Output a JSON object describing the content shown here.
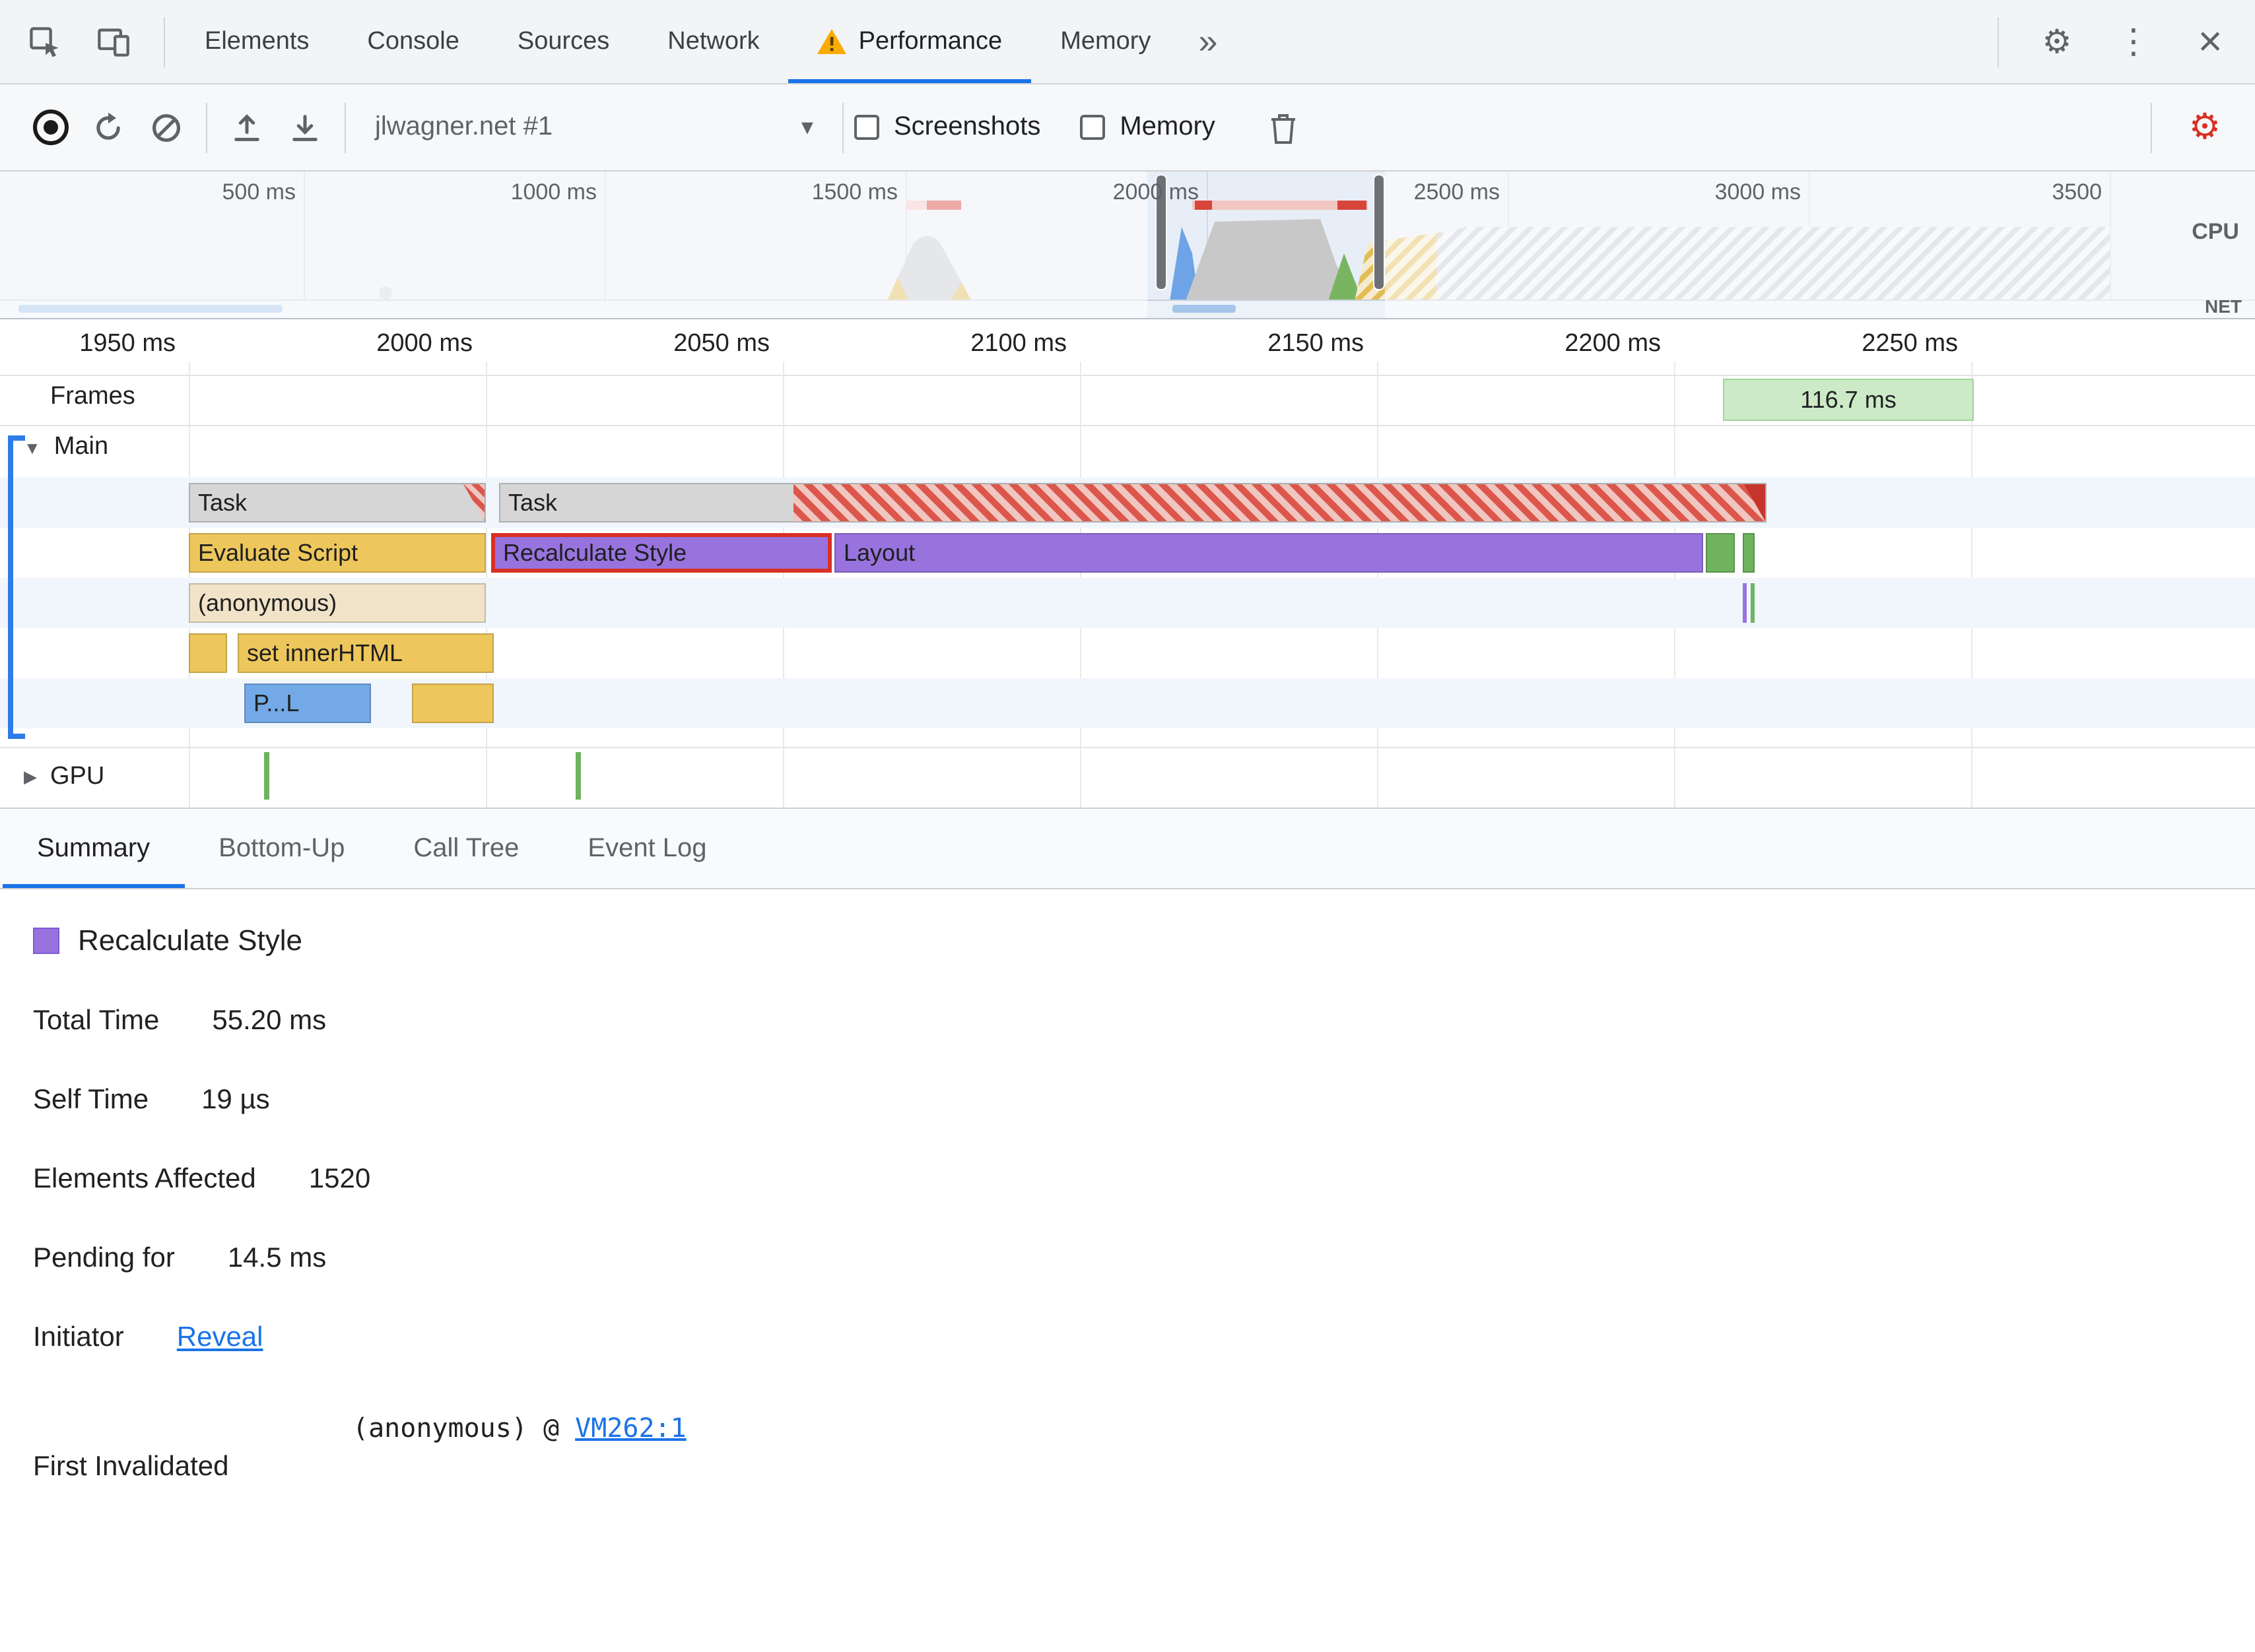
{
  "icons": {
    "gear": "⚙",
    "gear_capture": "⚙",
    "kebab": "⋮",
    "close": "×",
    "more_tabs": "»",
    "dropdown": "▾",
    "collapse_open": "▼",
    "collapse_closed": "▶"
  },
  "colors": {
    "accent_blue": "#1a73e8",
    "selection_red": "#d93025",
    "task_gray": "#d6d6d6",
    "scripting_yellow": "#eec75c",
    "rendering_purple": "#9873de",
    "painting_green": "#6fb35f",
    "parse_blue": "#73a9e6",
    "frame_green": "#cdeac6",
    "warning_orange": "#f9ab00"
  },
  "tabbar": {
    "tabs": [
      "Elements",
      "Console",
      "Sources",
      "Network",
      "Performance",
      "Memory"
    ]
  },
  "toolbar": {
    "profile": "jlwagner.net #1",
    "screenshots": "Screenshots",
    "memory": "Memory"
  },
  "overview": {
    "ruler": [
      "500 ms",
      "1000 ms",
      "1500 ms",
      "2000 ms",
      "2500 ms",
      "3000 ms",
      "3500"
    ],
    "cpu": "CPU",
    "net": "NET"
  },
  "detail": {
    "ruler": [
      "1950 ms",
      "2000 ms",
      "2050 ms",
      "2100 ms",
      "2150 ms",
      "2200 ms",
      "2250 ms"
    ],
    "frames": "Frames",
    "frame_duration": "116.7 ms",
    "main": "Main",
    "gpu": "GPU"
  },
  "flame": {
    "task1": "Task",
    "task2": "Task",
    "evaluate_script": "Evaluate Script",
    "recalculate_style": "Recalculate Style",
    "layout": "Layout",
    "anonymous": "(anonymous)",
    "set_inner_html": "set innerHTML",
    "parse_html": "P...L"
  },
  "bottom_tabs": [
    "Summary",
    "Bottom-Up",
    "Call Tree",
    "Event Log"
  ],
  "summary": {
    "event": "Recalculate Style",
    "total_time_label": "Total Time",
    "total_time": "55.20 ms",
    "self_time_label": "Self Time",
    "self_time": "19 µs",
    "elements_label": "Elements Affected",
    "elements": "1520",
    "pending_label": "Pending for",
    "pending": "14.5 ms",
    "initiator_label": "Initiator",
    "initiator_link": "Reveal",
    "first_invalidated_label": "First Invalidated",
    "first_invalidated_value": "(anonymous) @ ",
    "first_invalidated_link": "VM262:1"
  }
}
